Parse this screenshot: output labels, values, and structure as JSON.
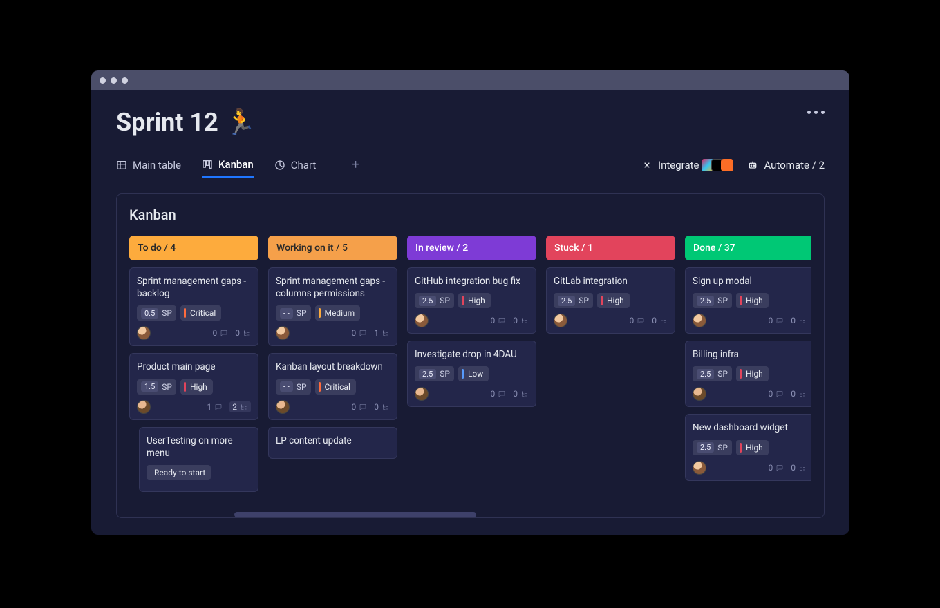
{
  "header": {
    "sprint_title": "Sprint 12",
    "sprint_emoji": "🏃"
  },
  "tabs": {
    "main_table": "Main table",
    "kanban": "Kanban",
    "chart": "Chart"
  },
  "actions": {
    "integrate": "Integrate",
    "automate": "Automate / 2"
  },
  "board": {
    "title": "Kanban",
    "sp_label": "SP"
  },
  "columns": [
    {
      "id": "todo",
      "label": "To do / 4"
    },
    {
      "id": "working",
      "label": "Working on it / 5"
    },
    {
      "id": "review",
      "label": "In review / 2"
    },
    {
      "id": "stuck",
      "label": "Stuck / 1"
    },
    {
      "id": "done",
      "label": "Done  / 37"
    }
  ],
  "cards": {
    "todo": [
      {
        "title": "Sprint management gaps - backlog",
        "sp": "0.5",
        "priority": "Critical",
        "pri_class": "critical",
        "comments": "0",
        "sub": "0"
      },
      {
        "title": "Product main page",
        "sp": "1.5",
        "priority": "High",
        "pri_class": "high",
        "comments": "1",
        "sub": "2",
        "subBoxed": true
      },
      {
        "title": "UserTesting on more menu",
        "nested": true,
        "ready": "Ready to start"
      }
    ],
    "working": [
      {
        "title": "Sprint management gaps - columns permissions",
        "sp": "- -",
        "priority": "Medium",
        "pri_class": "medium",
        "comments": "0",
        "sub": "1"
      },
      {
        "title": "Kanban layout breakdown",
        "sp": "- -",
        "priority": "Critical",
        "pri_class": "critical",
        "comments": "0",
        "sub": "0"
      },
      {
        "title": "LP content update",
        "partial": true
      }
    ],
    "review": [
      {
        "title": "GitHub integration bug fix",
        "sp": "2.5",
        "priority": "High",
        "pri_class": "high",
        "comments": "0",
        "sub": "0"
      },
      {
        "title": "Investigate drop in 4DAU",
        "sp": "2.5",
        "priority": "Low",
        "pri_class": "low",
        "comments": "0",
        "sub": "0"
      }
    ],
    "stuck": [
      {
        "title": "GitLab integration",
        "sp": "2.5",
        "priority": "High",
        "pri_class": "high",
        "comments": "0",
        "sub": "0"
      }
    ],
    "done": [
      {
        "title": "Sign up modal",
        "sp": "2.5",
        "priority": "High",
        "pri_class": "high",
        "comments": "0",
        "sub": "0"
      },
      {
        "title": "Billing infra",
        "sp": "2.5",
        "priority": "High",
        "pri_class": "high",
        "comments": "0",
        "sub": "0"
      },
      {
        "title": "New dashboard widget",
        "sp": "2.5",
        "priority": "High",
        "pri_class": "high",
        "comments": "0",
        "sub": "0"
      }
    ]
  }
}
